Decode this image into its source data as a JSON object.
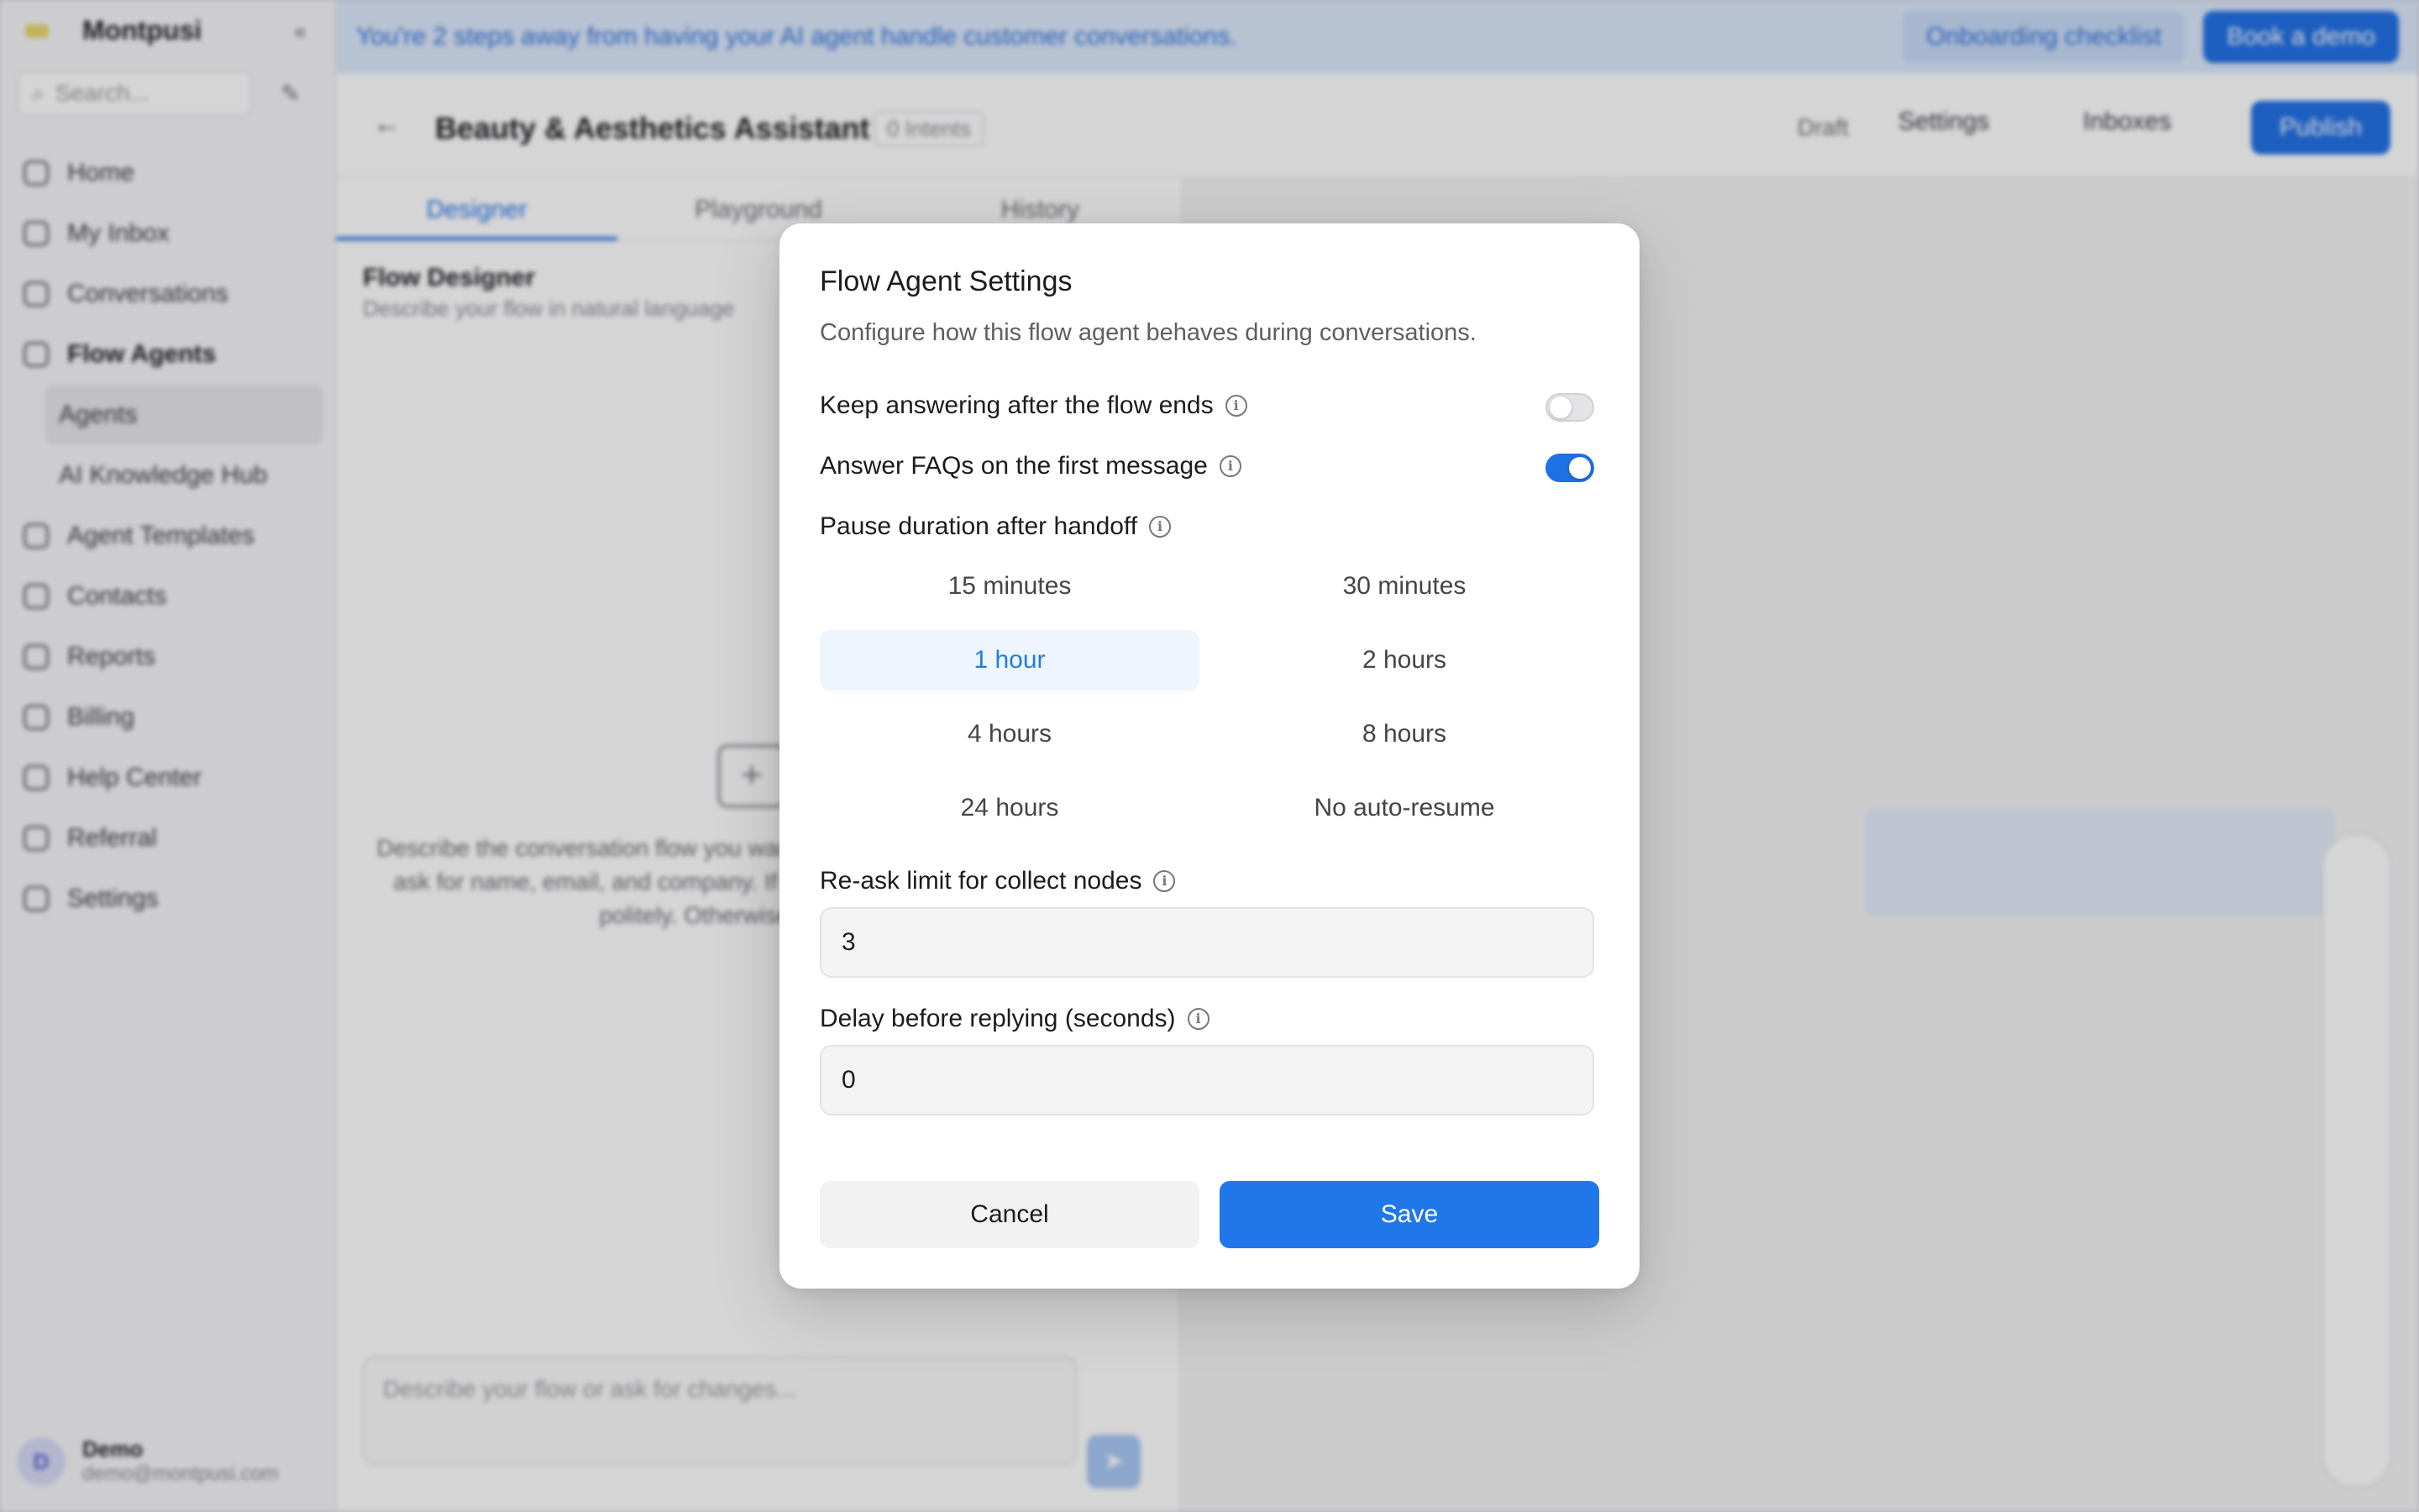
{
  "background": {
    "brand": "Montpusi",
    "search_placeholder": "Search...",
    "nav": [
      {
        "label": "Home"
      },
      {
        "label": "My Inbox"
      },
      {
        "label": "Conversations"
      },
      {
        "label": "Flow Agents"
      },
      {
        "label": "Agents"
      },
      {
        "label": "AI Knowledge Hub"
      },
      {
        "label": "Agent Templates"
      },
      {
        "label": "Contacts"
      },
      {
        "label": "Reports"
      },
      {
        "label": "Billing"
      },
      {
        "label": "Help Center"
      },
      {
        "label": "Referral"
      },
      {
        "label": "Settings"
      }
    ],
    "user": {
      "initial": "D",
      "name": "Demo",
      "email": "demo@montpusi.com"
    },
    "banner": {
      "text": "You're 2 steps away from having your AI agent handle customer conversations.",
      "onboarding": "Onboarding checklist",
      "demo": "Book a demo"
    },
    "topbar": {
      "title": "Beauty & Aesthetics Assistant",
      "edit_tag": "0 Intents",
      "draft": "Draft",
      "settings": "Settings",
      "inboxes": "Inboxes",
      "publish": "Publish"
    },
    "tabs": [
      "Designer",
      "Playground",
      "History"
    ],
    "designer": {
      "title": "Flow Designer",
      "subtitle": "Describe your flow in natural language",
      "description": "Describe the conversation flow you want. For example, \"Greet the user, ask for name, email, and company. If they ask about pricing, answer politely. Otherwise hand off.\"",
      "composer_placeholder": "Describe your flow or ask for changes..."
    }
  },
  "modal": {
    "title": "Flow Agent Settings",
    "description": "Configure how this flow agent behaves during conversations.",
    "keep_answering": {
      "label": "Keep answering after the flow ends",
      "enabled": false
    },
    "answer_faqs": {
      "label": "Answer FAQs on the first message",
      "enabled": true
    },
    "pause": {
      "label": "Pause duration after handoff",
      "options": [
        "15 minutes",
        "30 minutes",
        "1 hour",
        "2 hours",
        "4 hours",
        "8 hours",
        "24 hours",
        "No auto-resume"
      ],
      "selected": "1 hour"
    },
    "reask": {
      "label": "Re-ask limit for collect nodes",
      "value": "3"
    },
    "delay": {
      "label": "Delay before replying (seconds)",
      "value": "0"
    },
    "cancel": "Cancel",
    "save": "Save",
    "colors": {
      "accent": "#1f77ea",
      "selected_bg": "#eef5fe",
      "selected_text": "#1f7fd8"
    }
  }
}
